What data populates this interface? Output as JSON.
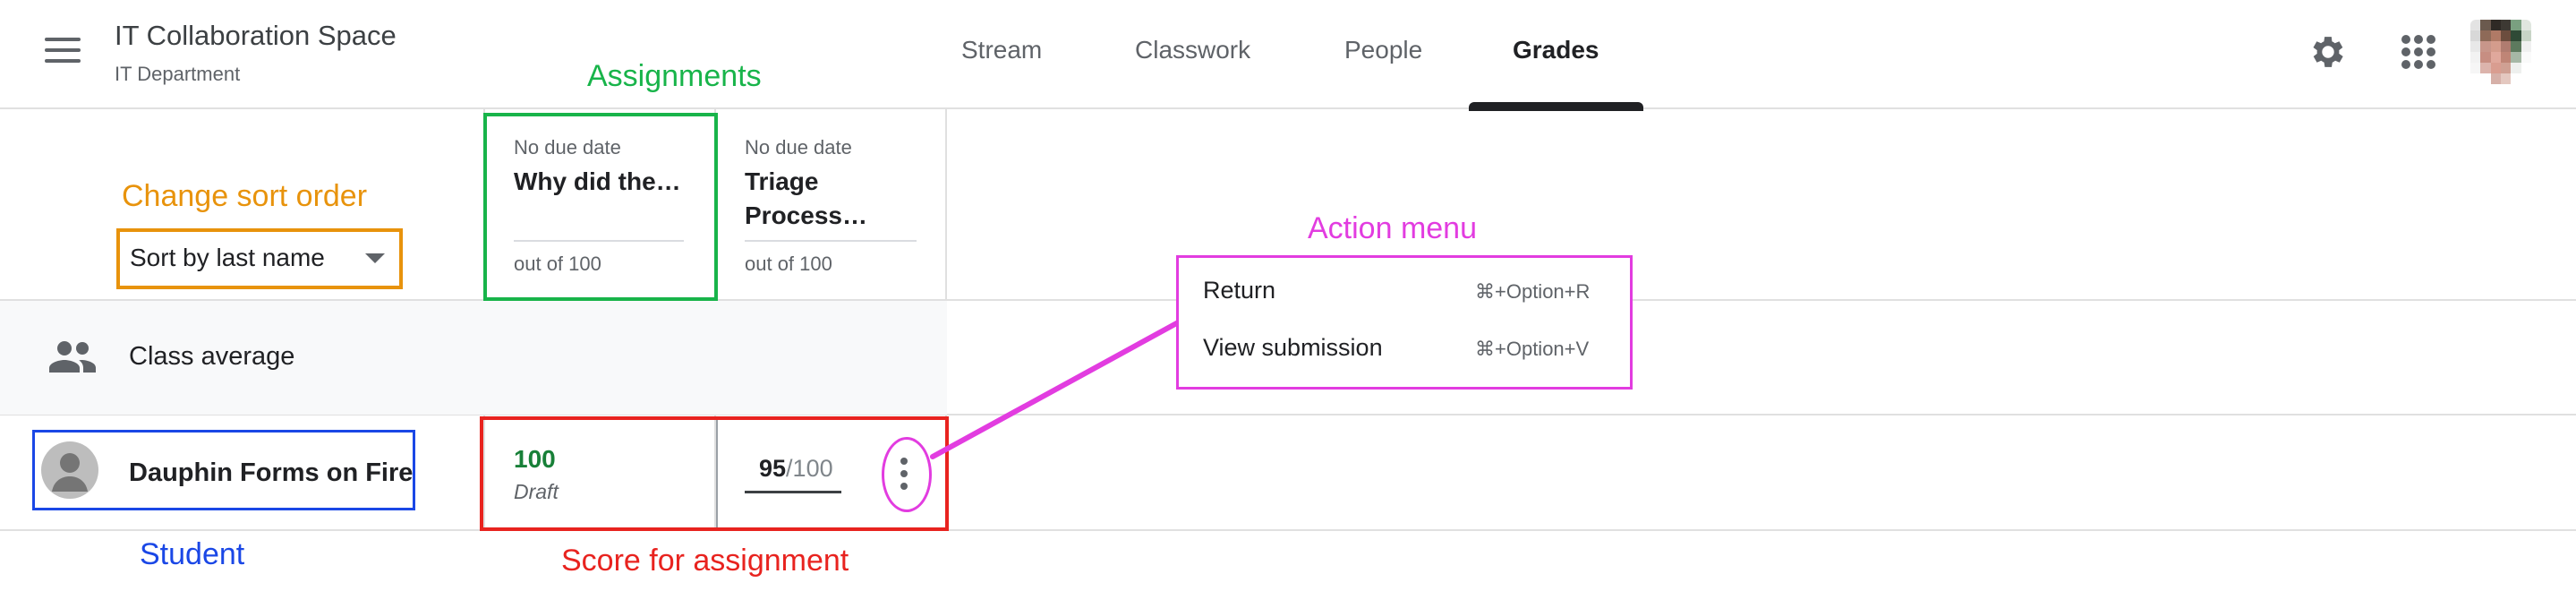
{
  "header": {
    "title": "IT Collaboration Space",
    "subtitle": "IT Department",
    "tabs": [
      {
        "label": "Stream"
      },
      {
        "label": "Classwork"
      },
      {
        "label": "People"
      },
      {
        "label": "Grades",
        "active": true
      }
    ],
    "icons": {
      "menu": "hamburger-menu-icon",
      "settings": "gear-icon",
      "apps": "apps-grid-icon",
      "account": "account-avatar"
    }
  },
  "annotations": {
    "assignments": "Assignments",
    "sort": "Change sort order",
    "action_menu": "Action menu",
    "student": "Student",
    "score": "Score for assignment"
  },
  "sort": {
    "selected": "Sort by last name"
  },
  "assignments": [
    {
      "due": "No due date",
      "title": "Why did the…",
      "out_of": "out of 100"
    },
    {
      "due": "No due date",
      "title": "Triage Process…",
      "out_of": "out of 100"
    }
  ],
  "class_average": {
    "label": "Class average",
    "icon": "people-icon"
  },
  "student": {
    "name": "Dauphin Forms on Fire",
    "grades": [
      {
        "score": "100",
        "status": "Draft"
      },
      {
        "score": "95",
        "denominator": "/100"
      }
    ]
  },
  "action_menu": {
    "items": [
      {
        "label": "Return",
        "shortcut": "⌘+Option+R"
      },
      {
        "label": "View submission",
        "shortcut": "⌘+Option+V"
      }
    ]
  },
  "colors": {
    "assignments_annotation": "#18b44a",
    "sort_annotation": "#e8930c",
    "action_annotation": "#e23ce0",
    "student_annotation": "#1a47e6",
    "score_annotation": "#e8231f",
    "grade_green": "#188038"
  }
}
